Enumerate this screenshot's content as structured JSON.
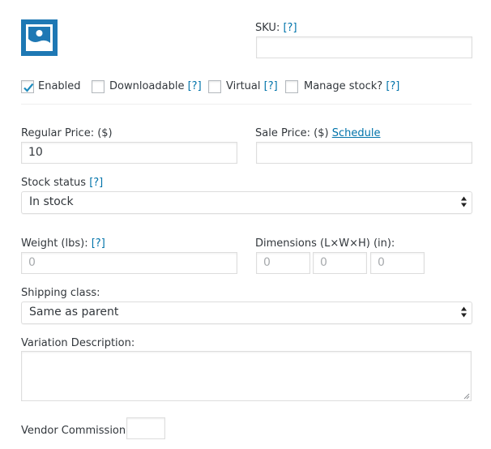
{
  "thumbnail": {
    "icon": "image-placeholder-icon",
    "color": "#1e78b4"
  },
  "sku": {
    "label": "SKU:",
    "help": "[?]",
    "value": ""
  },
  "options": {
    "enabled": {
      "label": "Enabled",
      "checked": true
    },
    "downloadable": {
      "label": "Downloadable",
      "help": "[?]",
      "checked": false
    },
    "virtual": {
      "label": "Virtual",
      "help": "[?]",
      "checked": false
    },
    "manage_stock": {
      "label": "Manage stock?",
      "help": "[?]",
      "checked": false
    }
  },
  "regular_price": {
    "label": "Regular Price: ($)",
    "value": "10"
  },
  "sale_price": {
    "label": "Sale Price: ($)",
    "link": "Schedule",
    "value": ""
  },
  "stock_status": {
    "label": "Stock status",
    "help": "[?]",
    "selected": "In stock"
  },
  "weight": {
    "label": "Weight (lbs):",
    "help": "[?]",
    "placeholder": "0"
  },
  "dimensions": {
    "label": "Dimensions (L×W×H) (in):",
    "length_placeholder": "0",
    "width_placeholder": "0",
    "height_placeholder": "0"
  },
  "shipping_class": {
    "label": "Shipping class:",
    "selected": "Same as parent"
  },
  "variation_description": {
    "label": "Variation Description:",
    "value": ""
  },
  "vendor_commission": {
    "label": "Vendor Commission:",
    "value": ""
  },
  "colors": {
    "link": "#0073aa",
    "text": "#32373c",
    "border": "#dddddd",
    "checkmark": "#1e8cbe"
  }
}
